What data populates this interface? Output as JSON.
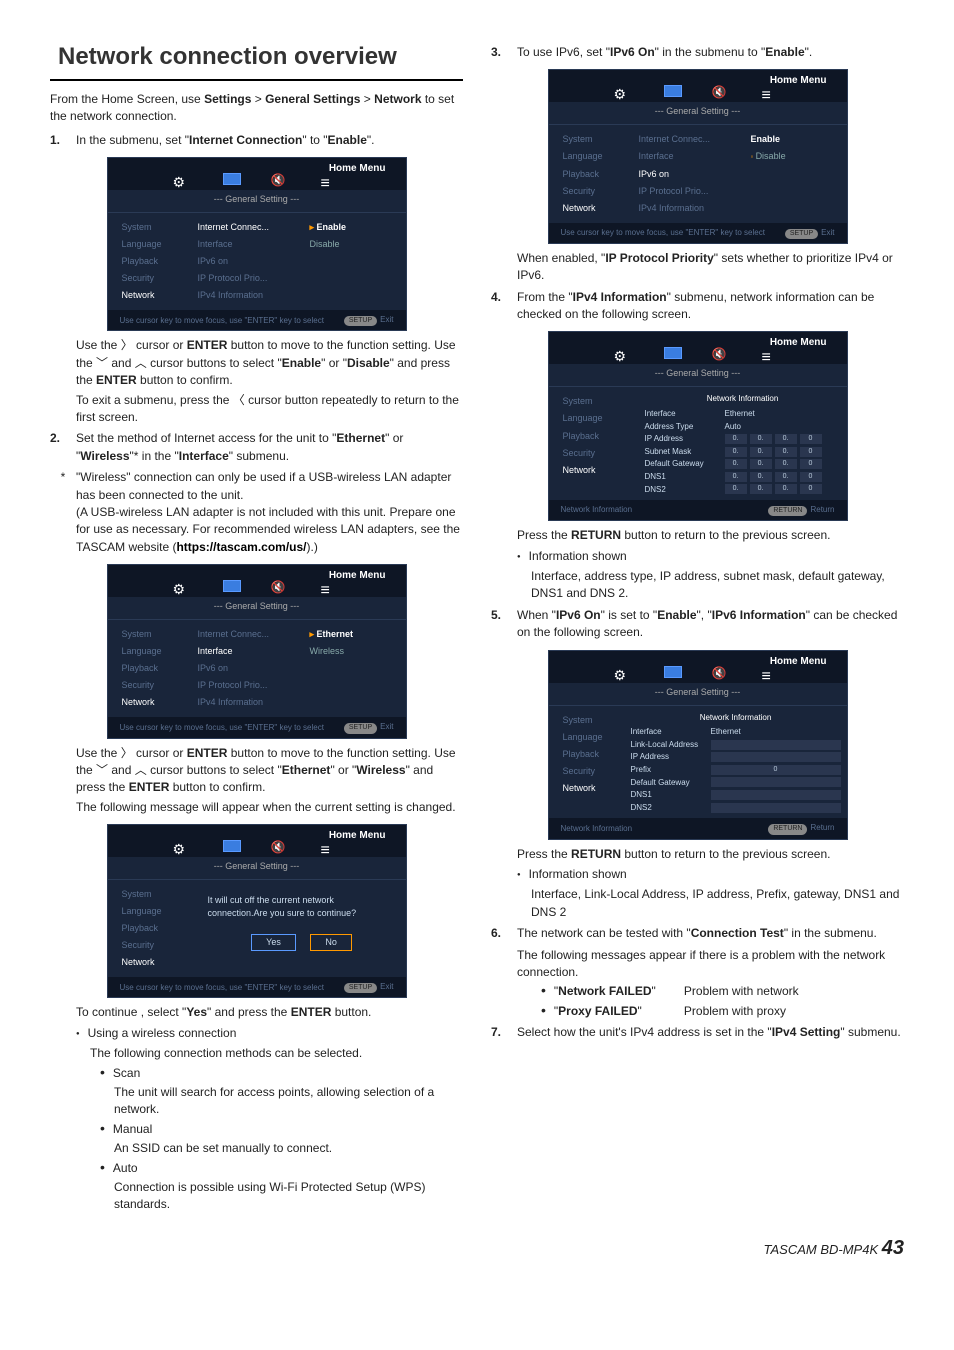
{
  "heading": "Network connection overview",
  "intro_1": "From the Home Screen, use ",
  "intro_b1": "Settings",
  "intro_gt1": " > ",
  "intro_b2": "General Settings",
  "intro_gt2": " > ",
  "intro_b3": "Network",
  "intro_2": " to set the network connection.",
  "step1_num": "1.",
  "step1_a": "In the submenu, set \"",
  "step1_b": "Internet Connection",
  "step1_c": "\" to \"",
  "step1_d": "Enable",
  "step1_e": "\".",
  "s1hint_a": "Use the ",
  "s1hint_b": " cursor or ",
  "s1hint_c": "ENTER",
  "s1hint_d": " button to move to the function setting. Use the ",
  "s1hint_e": " and ",
  "s1hint_f": " cursor buttons to select \"",
  "s1hint_g": "Enable",
  "s1hint_h": "\" or \"",
  "s1hint_i": "Disable",
  "s1hint_j": "\" and press the ",
  "s1hint_k": "ENTER",
  "s1hint_l": " button to confirm.",
  "s1hint2_a": "To exit a submenu, press the ",
  "s1hint2_b": " cursor button repeatedly to return to the first screen.",
  "step2_num": "2.",
  "step2_a": "Set the method of Internet access for the unit to \"",
  "step2_b": "Ethernet",
  "step2_c": "\" or \"",
  "step2_d": "Wireless",
  "step2_e": "\"* in the \"",
  "step2_f": "Interface",
  "step2_g": "\" submenu.",
  "ast_mark": "*",
  "ast_a": "\"Wireless\" connection can only be used if a USB-wireless LAN adapter has been connected to the unit.",
  "ast_b": "(A USB-wireless LAN adapter is not included with this unit. Prepare one for use as necessary. For recommended wireless LAN adapters, see the TASCAM website (",
  "ast_link": "https://tascam.com/us/",
  "ast_c": ").)",
  "s2hint_a": "Use the ",
  "s2hint_b": " cursor or ",
  "s2hint_c": "ENTER",
  "s2hint_d": " button to move to the function setting. Use the ",
  "s2hint_e": " and ",
  "s2hint_f": " cursor buttons to select \"",
  "s2hint_g": "Ethernet",
  "s2hint_h": "\" or \"",
  "s2hint_i": "Wireless",
  "s2hint_j": "\" and press the ",
  "s2hint_k": "ENTER",
  "s2hint_l": " button to confirm.",
  "s2msg": "The following message will appear when the current setting is changed.",
  "s2cont_a": "To continue , select \"",
  "s2cont_b": "Yes",
  "s2cont_c": "\" and press the ",
  "s2cont_d": "ENTER",
  "s2cont_e": " button.",
  "wc_head": "Using a wireless connection",
  "wc_intro": "The following connection methods can be selected.",
  "wc_scan": "Scan",
  "wc_scan_d": "The unit will search for access points, allowing selection of a network.",
  "wc_man": "Manual",
  "wc_man_d": "An SSID can be set manually to connect.",
  "wc_auto": "Auto",
  "wc_auto_d": "Connection is possible using Wi-Fi Protected Setup (WPS) standards.",
  "step3_num": "3.",
  "step3_a": "To use IPv6, set \"",
  "step3_b": "IPv6 On",
  "step3_c": "\" in the submenu to \"",
  "step3_d": "Enable",
  "step3_e": "\".",
  "s3hint_a": "When enabled, \"",
  "s3hint_b": "IP Protocol Priority",
  "s3hint_c": "\" sets whether to prioritize IPv4 or IPv6.",
  "step4_num": "4.",
  "step4_a": "From the \"",
  "step4_b": "IPv4 Information",
  "step4_c": "\" submenu, network information can be checked on the following screen.",
  "s4ret_a": "Press the ",
  "s4ret_b": "RETURN",
  "s4ret_c": " button to return to the previous screen.",
  "s4info": "Information shown",
  "s4info_d": "Interface, address type, IP address, subnet mask, default gateway, DNS1 and DNS 2.",
  "step5_num": "5.",
  "step5_a": "When \"",
  "step5_b": "IPv6 On",
  "step5_c": "\" is set to \"",
  "step5_d": "Enable",
  "step5_e": "\", \"",
  "step5_f": "IPv6 Information",
  "step5_g": "\" can be checked on the following screen.",
  "s5ret_a": "Press the ",
  "s5ret_b": "RETURN",
  "s5ret_c": " button to return to the previous screen.",
  "s5info": "Information shown",
  "s5info_d": "Interface, Link-Local Address, IP address, Prefix, gateway, DNS1 and DNS 2",
  "step6_num": "6.",
  "step6_a": "The network can be tested with \"",
  "step6_b": "Connection Test",
  "step6_c": "\" in the submenu.",
  "s6msg": "The following messages appear if there is a problem with the network connection.",
  "s6_nf": "Network FAILED",
  "s6_nf_d": "Problem with network",
  "s6_pf": "Proxy FAILED",
  "s6_pf_d": "Problem with proxy",
  "step7_num": "7.",
  "step7_a": "Select how the unit's IPv4 address is set in the \"",
  "step7_b": "IPv4 Setting",
  "step7_c": "\" submenu.",
  "footer_model": "TASCAM BD-MP4K",
  "footer_page": "43",
  "shot": {
    "home": "Home Menu",
    "crumb": "--- General Setting ---",
    "side": [
      "System",
      "Language",
      "Playback",
      "Security",
      "Network"
    ],
    "mid1": [
      "Internet Connec...",
      "Interface",
      "IPv6 on",
      "IP Protocol Prio...",
      "IPv4 Information"
    ],
    "mid2": [
      "Internet Connec...",
      "Interface",
      "IPv6 on",
      "IP Protocol Prio...",
      "IPv4 Information"
    ],
    "opts1": [
      "Enable",
      "Disable"
    ],
    "opts2": [
      "Ethernet",
      "Wireless"
    ],
    "opts3": [
      "Enable",
      "Disable"
    ],
    "f_hint": "Use cursor key to move focus, use \"ENTER\" key to select",
    "f_setup": "SETUP",
    "f_exit": "Exit",
    "f_return": "RETURN",
    "f_returnlbl": "Return",
    "f_netinfo": "Network Information",
    "confirm_l1": "It will cut off the current network",
    "confirm_l2": "connection.Are you sure to continue?",
    "yes": "Yes",
    "no": "No",
    "ni_hdr": "Network Information",
    "ni4": {
      "interface": "Interface",
      "interface_v": "Ethernet",
      "addrtype": "Address Type",
      "addrtype_v": "Auto",
      "ip": "IP Address",
      "mask": "Subnet Mask",
      "gw": "Default Gateway",
      "dns1": "DNS1",
      "dns2": "DNS2",
      "zero": "0."
    },
    "ni6": {
      "interface": "Interface",
      "interface_v": "Ethernet",
      "lla": "Link-Local Address",
      "ip": "IP Address",
      "prefix": "Prefix",
      "gw": "Default Gateway",
      "dns1": "DNS1",
      "dns2": "DNS2",
      "zero": "0"
    }
  }
}
